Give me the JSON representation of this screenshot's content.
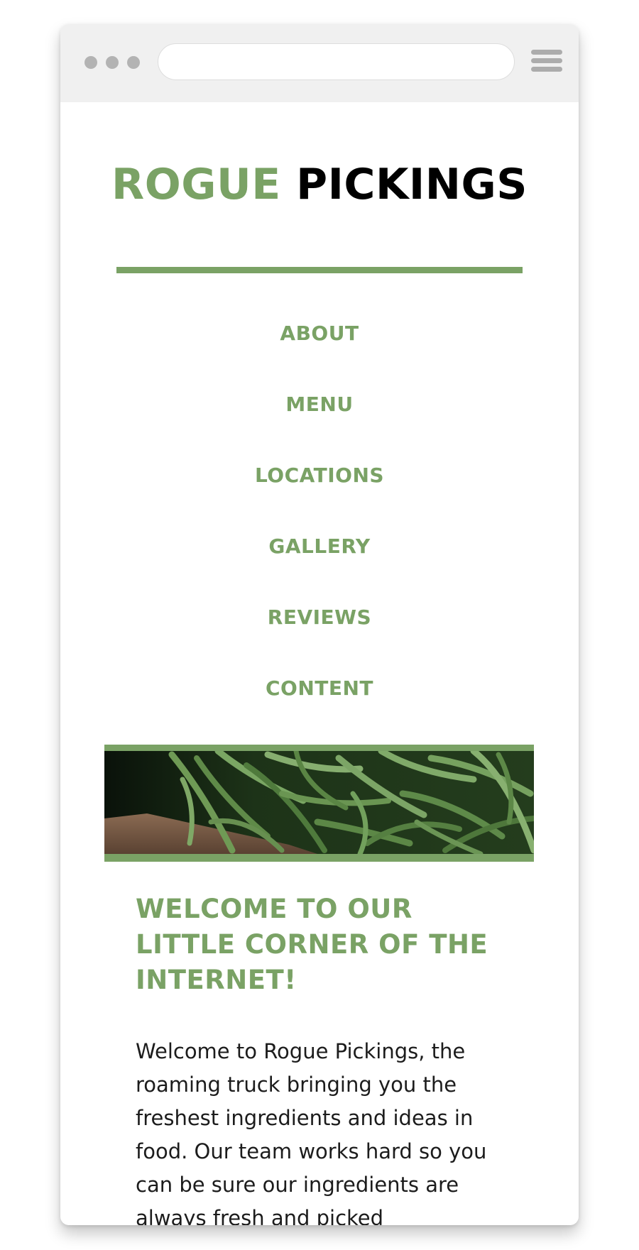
{
  "site": {
    "title_part1": "ROGUE",
    "title_part2": "PICKINGS"
  },
  "nav": {
    "items": [
      {
        "label": "ABOUT"
      },
      {
        "label": "MENU"
      },
      {
        "label": "LOCATIONS"
      },
      {
        "label": "GALLERY"
      },
      {
        "label": "REVIEWS"
      },
      {
        "label": "CONTENT"
      }
    ]
  },
  "welcome": {
    "heading": "WELCOME TO OUR LITTLE CORNER OF THE INTERNET!",
    "body": "Welcome to Rogue Pickings, the roaming truck bringing you the freshest ingredients and ideas in food. Our team works hard so you can be sure our ingredients are always fresh and picked"
  },
  "colors": {
    "accent": "#7aa265",
    "title_dark": "#000000",
    "chrome": "#f0f0f0"
  },
  "icons": {
    "window_controls": "three-dots-icon",
    "menu": "hamburger-menu-icon"
  }
}
